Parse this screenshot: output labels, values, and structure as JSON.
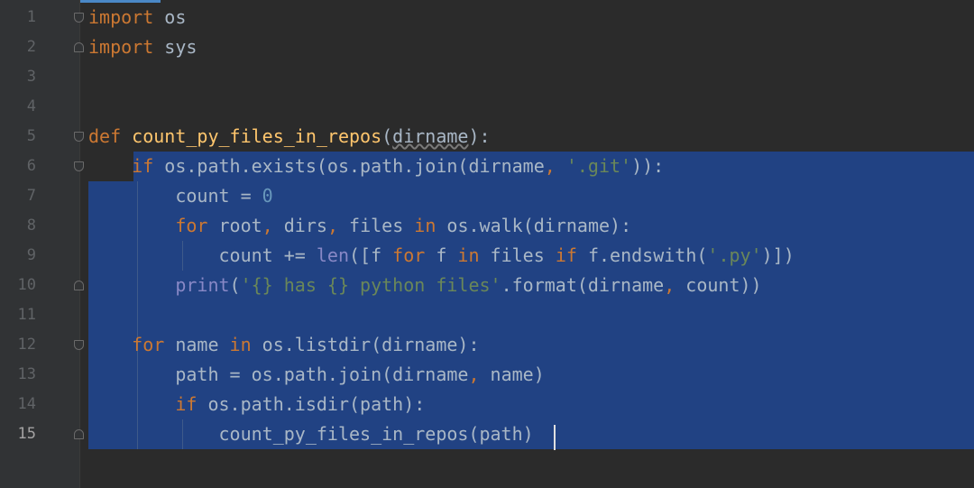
{
  "editor": {
    "language": "python",
    "selection_color": "#214283",
    "gutter": {
      "line_numbers": [
        "1",
        "2",
        "3",
        "4",
        "5",
        "6",
        "7",
        "8",
        "9",
        "10",
        "11",
        "12",
        "13",
        "14",
        "15"
      ],
      "current_line": "15"
    },
    "code_lines": [
      {
        "segments": [
          {
            "t": "import",
            "c": "kw"
          },
          {
            "t": " os",
            "c": ""
          }
        ]
      },
      {
        "segments": [
          {
            "t": "import",
            "c": "kw"
          },
          {
            "t": " sys",
            "c": ""
          }
        ]
      },
      {
        "segments": []
      },
      {
        "segments": []
      },
      {
        "segments": [
          {
            "t": "def",
            "c": "kw"
          },
          {
            "t": " ",
            "c": ""
          },
          {
            "t": "count_py_files_in_repos",
            "c": "fn"
          },
          {
            "t": "(",
            "c": ""
          },
          {
            "t": "dirname",
            "c": "param"
          },
          {
            "t": "):",
            "c": ""
          }
        ]
      },
      {
        "segments": [
          {
            "t": "    ",
            "c": ""
          },
          {
            "t": "if",
            "c": "kw"
          },
          {
            "t": " os.path.exists(os.path.join(dirname",
            "c": ""
          },
          {
            "t": ",",
            "c": "kw"
          },
          {
            "t": " ",
            "c": ""
          },
          {
            "t": "'.git'",
            "c": "str"
          },
          {
            "t": ")):",
            "c": ""
          }
        ]
      },
      {
        "segments": [
          {
            "t": "        count = ",
            "c": ""
          },
          {
            "t": "0",
            "c": "num"
          }
        ]
      },
      {
        "segments": [
          {
            "t": "        ",
            "c": ""
          },
          {
            "t": "for",
            "c": "kw"
          },
          {
            "t": " root",
            "c": ""
          },
          {
            "t": ",",
            "c": "kw"
          },
          {
            "t": " dirs",
            "c": ""
          },
          {
            "t": ",",
            "c": "kw"
          },
          {
            "t": " files ",
            "c": ""
          },
          {
            "t": "in",
            "c": "kw"
          },
          {
            "t": " os.walk(dirname):",
            "c": ""
          }
        ]
      },
      {
        "segments": [
          {
            "t": "            count += ",
            "c": ""
          },
          {
            "t": "len",
            "c": "bi"
          },
          {
            "t": "([f ",
            "c": ""
          },
          {
            "t": "for",
            "c": "kw"
          },
          {
            "t": " f ",
            "c": ""
          },
          {
            "t": "in",
            "c": "kw"
          },
          {
            "t": " files ",
            "c": ""
          },
          {
            "t": "if",
            "c": "kw"
          },
          {
            "t": " f.endswith(",
            "c": ""
          },
          {
            "t": "'.py'",
            "c": "str"
          },
          {
            "t": ")])",
            "c": ""
          }
        ]
      },
      {
        "segments": [
          {
            "t": "        ",
            "c": ""
          },
          {
            "t": "print",
            "c": "bi"
          },
          {
            "t": "(",
            "c": ""
          },
          {
            "t": "'{} has {} python files'",
            "c": "str"
          },
          {
            "t": ".format(dirname",
            "c": ""
          },
          {
            "t": ",",
            "c": "kw"
          },
          {
            "t": " count))",
            "c": ""
          }
        ]
      },
      {
        "segments": []
      },
      {
        "segments": [
          {
            "t": "    ",
            "c": ""
          },
          {
            "t": "for",
            "c": "kw"
          },
          {
            "t": " name ",
            "c": ""
          },
          {
            "t": "in",
            "c": "kw"
          },
          {
            "t": " os.listdir(dirname):",
            "c": ""
          }
        ]
      },
      {
        "segments": [
          {
            "t": "        path = os.path.join(dirname",
            "c": ""
          },
          {
            "t": ",",
            "c": "kw"
          },
          {
            "t": " name)",
            "c": ""
          }
        ]
      },
      {
        "segments": [
          {
            "t": "        ",
            "c": ""
          },
          {
            "t": "if",
            "c": "kw"
          },
          {
            "t": " os.path.isdir(path):",
            "c": ""
          }
        ]
      },
      {
        "segments": [
          {
            "t": "            count_py_files_in_repos(path)",
            "c": ""
          }
        ]
      }
    ]
  }
}
